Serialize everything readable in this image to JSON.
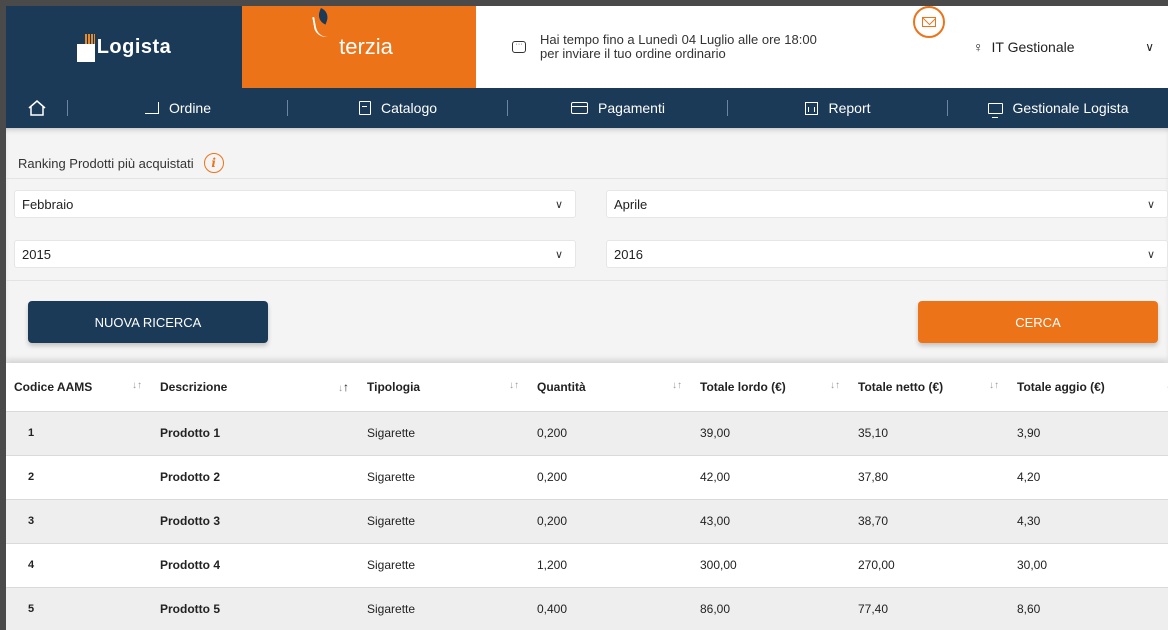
{
  "header": {
    "brand_left": "Logista",
    "brand_right": "Terzia",
    "message_line1": "Hai tempo fino a Lunedì 04 Luglio alle ore 18:00",
    "message_line2": "per inviare il tuo ordine ordinario",
    "user": "IT Gestionale"
  },
  "nav": {
    "items": [
      {
        "label": "Ordine"
      },
      {
        "label": "Catalogo"
      },
      {
        "label": "Pagamenti"
      },
      {
        "label": "Report"
      },
      {
        "label": "Gestionale Logista"
      }
    ]
  },
  "filters": {
    "title": "Ranking Prodotti più acquistati",
    "month_from": "Febbraio",
    "month_to": "Aprile",
    "year_from": "2015",
    "year_to": "2016",
    "reset_label": "NUOVA RICERCA",
    "search_label": "CERCA"
  },
  "table": {
    "columns": [
      "Codice AAMS",
      "Descrizione",
      "Tipologia",
      "Quantità",
      "Totale lordo (€)",
      "Totale netto (€)",
      "Totale aggio (€)"
    ],
    "rows": [
      {
        "code": "1",
        "desc": "Prodotto 1",
        "type": "Sigarette",
        "qty": "0,200",
        "gross": "39,00",
        "net": "35,10",
        "aggio": "3,90"
      },
      {
        "code": "2",
        "desc": "Prodotto 2",
        "type": "Sigarette",
        "qty": "0,200",
        "gross": "42,00",
        "net": "37,80",
        "aggio": "4,20"
      },
      {
        "code": "3",
        "desc": "Prodotto 3",
        "type": "Sigarette",
        "qty": "0,200",
        "gross": "43,00",
        "net": "38,70",
        "aggio": "4,30"
      },
      {
        "code": "4",
        "desc": "Prodotto 4",
        "type": "Sigarette",
        "qty": "1,200",
        "gross": "300,00",
        "net": "270,00",
        "aggio": "30,00"
      },
      {
        "code": "5",
        "desc": "Prodotto 5",
        "type": "Sigarette",
        "qty": "0,400",
        "gross": "86,00",
        "net": "77,40",
        "aggio": "8,60"
      }
    ]
  },
  "colors": {
    "navy": "#1b3a57",
    "orange": "#ed7319"
  }
}
